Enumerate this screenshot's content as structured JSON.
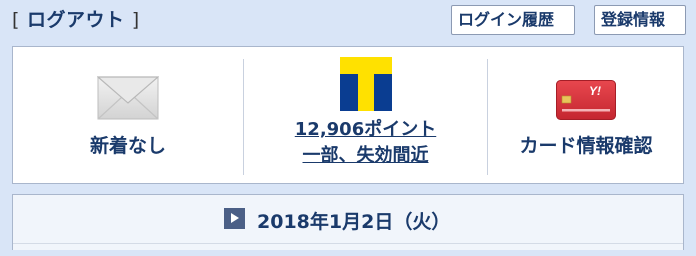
{
  "header": {
    "logout_bracket_open": "[",
    "logout_label": "ログアウト",
    "logout_bracket_close": "]",
    "login_history_label": "ログイン履歴",
    "account_info_label": "登録情報"
  },
  "panel": {
    "mail": {
      "icon": "envelope-icon",
      "label": "新着なし"
    },
    "points": {
      "icon": "t-point-icon",
      "line1": "12,906ポイント",
      "line2": "一部、失効間近"
    },
    "card": {
      "icon": "credit-card-icon",
      "label": "カード情報確認"
    }
  },
  "date_bar": {
    "icon": "play-icon",
    "date": "2018年1月2日（火）"
  },
  "colors": {
    "background": "#d9e5f7",
    "text": "#1a3a6b",
    "tpoint_yellow": "#ffe100",
    "tpoint_blue": "#0a3d91",
    "card_red": "#d9363e"
  }
}
